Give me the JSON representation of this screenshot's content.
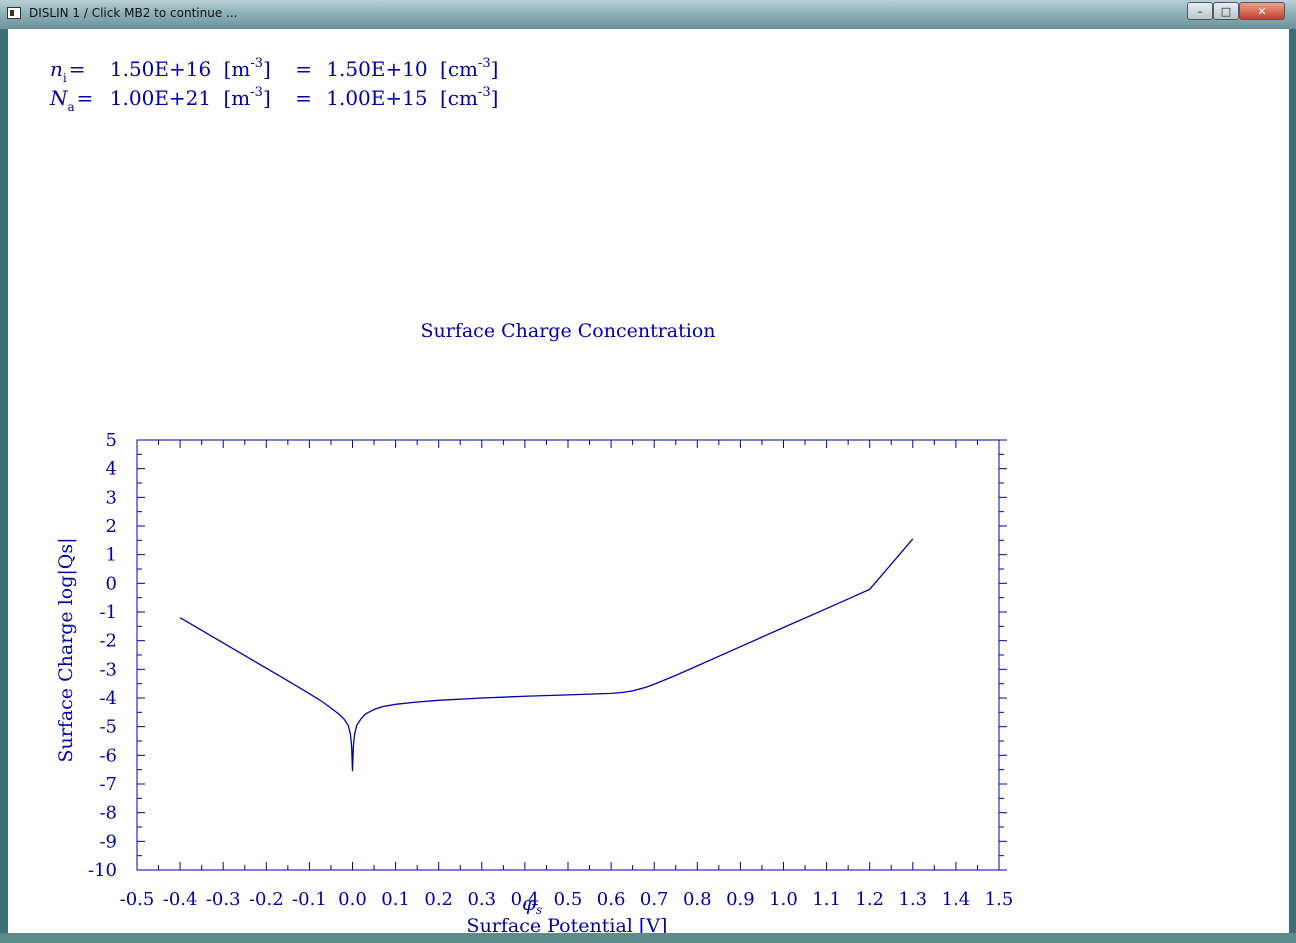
{
  "window": {
    "title": "DISLIN 1 / Click MB2 to continue ...",
    "buttons": {
      "minimize": "–",
      "maximize": "□",
      "close": "✕"
    }
  },
  "params": {
    "ni": {
      "sym": "n",
      "sub": "i",
      "eq": "=",
      "v1": "1.50E+16",
      "u1": "m",
      "e1": "-3",
      "v2": "1.50E+10",
      "u2": "cm",
      "e2": "-3"
    },
    "na": {
      "sym": "N",
      "sub": "a",
      "eq": "=",
      "v1": "1.00E+21",
      "u1": "m",
      "e1": "-3",
      "v2": "1.00E+15",
      "u2": "cm",
      "e2": "-3"
    }
  },
  "colors": {
    "ink": "#0000aa",
    "titlebar": "#9fbec5",
    "close": "#c4412b"
  },
  "chart_data": {
    "type": "line",
    "title": "Surface Charge Concentration",
    "xlabel": "Surface Potential [V]",
    "xlabel_symbol": "φ",
    "xlabel_symbol_sub": "s",
    "ylabel": "Surface Charge log|Qs|",
    "xlim": [
      -0.5,
      1.5
    ],
    "ylim": [
      -10,
      5
    ],
    "xticks": [
      "-0.5",
      "-0.4",
      "-0.3",
      "-0.2",
      "-0.1",
      "0.0",
      "0.1",
      "0.2",
      "0.3",
      "0.4",
      "0.5",
      "0.6",
      "0.7",
      "0.8",
      "0.9",
      "1.0",
      "1.1",
      "1.2",
      "1.3",
      "1.4",
      "1.5"
    ],
    "yticks": [
      "5",
      "4",
      "3",
      "2",
      "1",
      "0",
      "-1",
      "-2",
      "-3",
      "-4",
      "-5",
      "-6",
      "-7",
      "-8",
      "-9",
      "-10"
    ],
    "grid": false,
    "series": [
      {
        "x": [
          -0.4,
          -0.35,
          -0.3,
          -0.25,
          -0.2,
          -0.15,
          -0.1,
          -0.07,
          -0.05,
          -0.03,
          -0.02,
          -0.01,
          -0.005,
          -0.002,
          0.0,
          0.002,
          0.005,
          0.01,
          0.02,
          0.03,
          0.05,
          0.07,
          0.1,
          0.15,
          0.2,
          0.3,
          0.4,
          0.5,
          0.6,
          0.63,
          0.65,
          0.68,
          0.7,
          0.75,
          0.8,
          0.9,
          1.0,
          1.1,
          1.2,
          1.3
        ],
        "y": [
          -1.2,
          -1.64,
          -2.08,
          -2.52,
          -2.96,
          -3.4,
          -3.85,
          -4.13,
          -4.35,
          -4.58,
          -4.73,
          -4.95,
          -5.25,
          -5.7,
          -6.55,
          -5.7,
          -5.25,
          -4.95,
          -4.72,
          -4.56,
          -4.4,
          -4.3,
          -4.22,
          -4.14,
          -4.08,
          -4.0,
          -3.94,
          -3.89,
          -3.84,
          -3.8,
          -3.75,
          -3.63,
          -3.52,
          -3.21,
          -2.88,
          -2.21,
          -1.54,
          -0.88,
          -0.21,
          1.55
        ]
      }
    ]
  }
}
